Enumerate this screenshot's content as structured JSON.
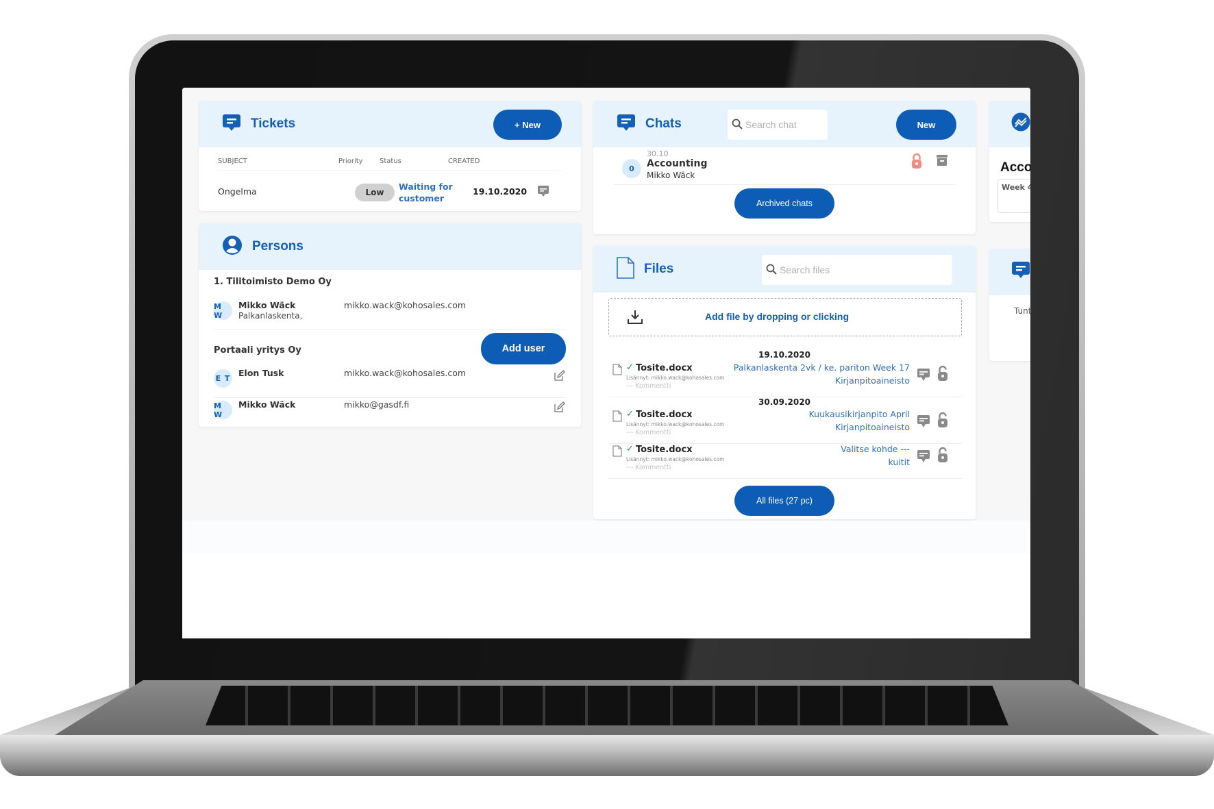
{
  "tickets": {
    "title": "Tickets",
    "new_button": "+ New",
    "columns": [
      "SUBJECT",
      "Priority",
      "Status",
      "CREATED"
    ],
    "rows": [
      {
        "subject": "Ongelma",
        "priority": "Low",
        "status_line1": "Waiting for",
        "status_line2": "customer",
        "created": "19.10.2020"
      }
    ]
  },
  "persons": {
    "title": "Persons",
    "add_user_button": "Add user",
    "groups": [
      {
        "org": "1. Tilitoimisto Demo Oy",
        "people": [
          {
            "initials": "M W",
            "name": "Mikko Wäck",
            "role": "Palkanlaskenta,",
            "email": "mikko.wack@kohosales.com"
          }
        ]
      },
      {
        "org": "Portaali yritys Oy",
        "people": [
          {
            "initials": "E T",
            "name": "Elon Tusk",
            "email": "mikko.wack@kohosales.com"
          },
          {
            "initials": "M W",
            "name": "Mikko Wäck",
            "email": "mikko@gasdf.fi"
          }
        ]
      }
    ]
  },
  "chats": {
    "title": "Chats",
    "search_placeholder": "Search chat",
    "new_button": "New",
    "items": [
      {
        "unread": "0",
        "date": "30.10",
        "title": "Accounting",
        "user": "Mikko Wäck"
      }
    ],
    "archived_button": "Archived chats"
  },
  "files": {
    "title": "Files",
    "search_placeholder": "Search files",
    "dropzone_label": "Add file by dropping or clicking",
    "groups": [
      {
        "date": "19.10.2020",
        "items": [
          {
            "name": "Tosite.docx",
            "added_by": "Lisännyt: mikko.wack@kohosales.com",
            "comment": "--- Kommentti",
            "target_line1": "Palkanlaskenta 2vk / ke. pariton Week 17",
            "target_line2": "Kirjanpitoaineisto"
          }
        ]
      },
      {
        "date": "30.09.2020",
        "items": [
          {
            "name": "Tosite.docx",
            "added_by": "Lisännyt: mikko.wack@kohosales.com",
            "comment": "--- Kommentti",
            "target_line1": "Kuukausikirjanpito April",
            "target_line2": "Kirjanpitoaineisto"
          },
          {
            "name": "Tosite.docx",
            "added_by": "Lisännyt: mikko.wack@kohosales.com",
            "comment": "--- Kommentti",
            "target_line1": "Valitse kohde ---",
            "target_line2": "kuitit"
          }
        ]
      }
    ],
    "all_files_button": "All files (27 pc)"
  },
  "right_column": {
    "accounting_title": "Acco",
    "accounting_week": "Week 4",
    "tunt_text": "Tunt"
  },
  "colors": {
    "brand": "#0d5cb6",
    "header_bg": "#e6f3fd",
    "link": "#2f6fbf",
    "lock_red": "#f28b82",
    "check_green": "#2d9a3d"
  }
}
